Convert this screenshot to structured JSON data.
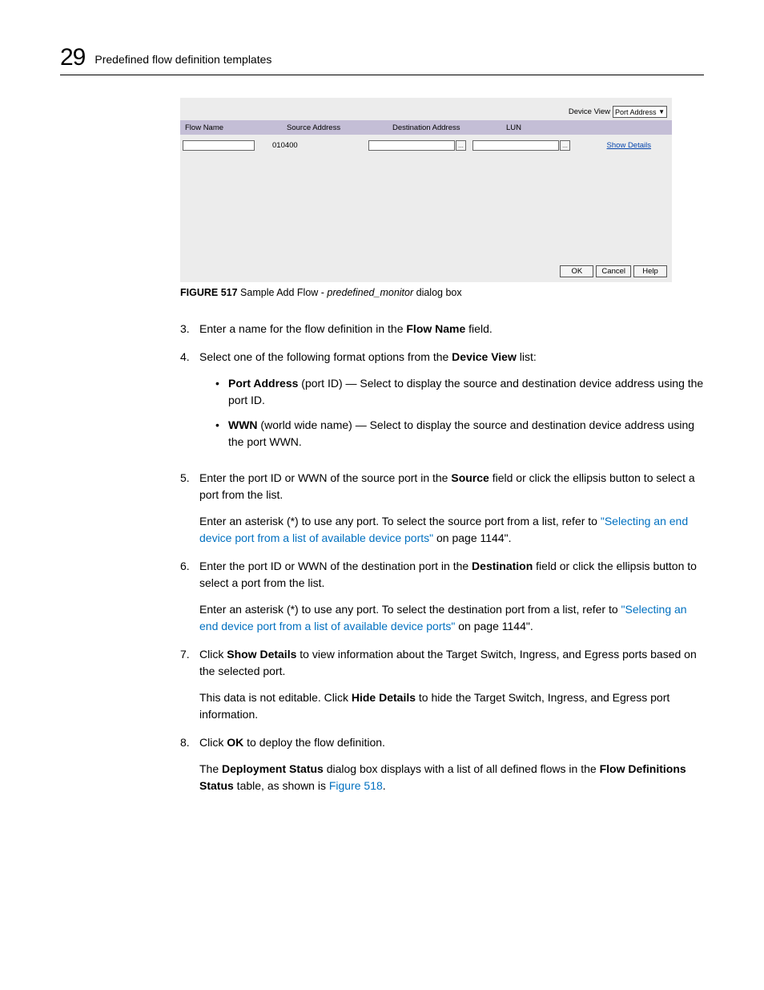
{
  "header": {
    "chapter_num": "29",
    "chapter_title": "Predefined flow definition templates"
  },
  "dialog": {
    "device_view_label": "Device View",
    "device_view_value": "Port Address",
    "columns": {
      "flow_name": "Flow Name",
      "src": "Source Address",
      "dst": "Destination Address",
      "lun": "LUN"
    },
    "row": {
      "flow_name": "",
      "src": "010400",
      "dst": "",
      "lun": ""
    },
    "ellipsis": "...",
    "show_details": "Show Details",
    "buttons": {
      "ok": "OK",
      "cancel": "Cancel",
      "help": "Help"
    }
  },
  "figure": {
    "label": "FIGURE 517",
    "pre": " Sample Add Flow - ",
    "em": "predefined_monitor",
    "post": " dialog box"
  },
  "steps": {
    "s3": {
      "num": "3.",
      "t1a": "Enter a name for the flow definition in the ",
      "t1b": "Flow Name",
      "t1c": " field."
    },
    "s4": {
      "num": "4.",
      "t1a": "Select one of the following format options from the ",
      "t1b": "Device View",
      "t1c": " list:",
      "b1a": "Port Address",
      "b1b": " (port ID) — Select to display the source and destination device address using the port ID.",
      "b2a": "WWN",
      "b2b": " (world wide name) — Select to display the source and destination device address using the port WWN."
    },
    "s5": {
      "num": "5.",
      "t1a": "Enter the port ID or WWN of the source port in the ",
      "t1b": "Source",
      "t1c": " field or click the ellipsis button to select a port from the list.",
      "t2a": "Enter an asterisk (*) to use any port. To select the source port from a list, refer to ",
      "link": "\"Selecting an end device port from a list of available device ports\"",
      "t2c": " on page 1144\"."
    },
    "s6": {
      "num": "6.",
      "t1a": "Enter the port ID or WWN of the destination port in the ",
      "t1b": "Destination",
      "t1c": " field or click the ellipsis button to select a port from the list.",
      "t2a": "Enter an asterisk (*) to use any port. To select the destination port from a list, refer to ",
      "link": "\"Selecting an end device port from a list of available device ports\"",
      "t2c": " on page 1144\"."
    },
    "s7": {
      "num": "7.",
      "t1a": "Click ",
      "t1b": "Show Details",
      "t1c": " to view information about the Target Switch, Ingress, and Egress ports based on the selected port.",
      "t2a": "This data is not editable. Click ",
      "t2b": "Hide Details",
      "t2c": " to hide the Target Switch, Ingress, and Egress port information."
    },
    "s8": {
      "num": "8.",
      "t1a": "Click ",
      "t1b": "OK",
      "t1c": " to deploy the flow definition.",
      "t2a": "The ",
      "t2b": "Deployment Status",
      "t2c": " dialog box displays with a list of all defined flows in the ",
      "t2d": "Flow Definitions Status",
      "t2e": " table, as shown is ",
      "link": "Figure 518",
      "t2g": "."
    }
  }
}
